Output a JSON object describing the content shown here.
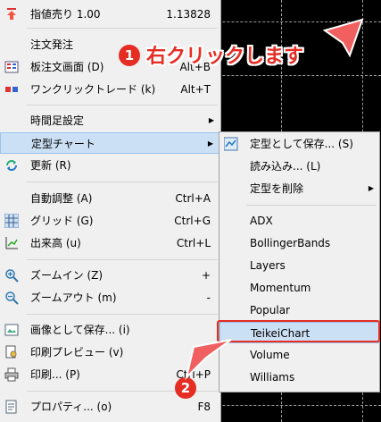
{
  "context_menu": {
    "items": [
      {
        "label": "指値売り 1.00",
        "shortcut": "1.13828",
        "icon": "sell-limit-arrow-icon"
      },
      {
        "label": "注文発注",
        "shortcut": "",
        "icon": ""
      },
      {
        "label": "板注文画面 (D)",
        "shortcut": "Alt+B",
        "icon": "order-book-icon"
      },
      {
        "label": "ワンクリックトレード (k)",
        "shortcut": "Alt+T",
        "icon": "one-click-trading-icon"
      },
      {
        "label": "時間足設定",
        "shortcut": "",
        "icon": ""
      },
      {
        "label": "定型チャート",
        "shortcut": "",
        "icon": ""
      },
      {
        "label": "更新 (R)",
        "shortcut": "",
        "icon": "refresh-icon"
      },
      {
        "label": "自動調整 (A)",
        "shortcut": "Ctrl+A",
        "icon": ""
      },
      {
        "label": "グリッド (G)",
        "shortcut": "Ctrl+G",
        "icon": "grid-icon"
      },
      {
        "label": "出来高 (u)",
        "shortcut": "Ctrl+L",
        "icon": "volume-icon"
      },
      {
        "label": "ズームイン (Z)",
        "shortcut": "+",
        "icon": "zoom-in-icon"
      },
      {
        "label": "ズームアウト (m)",
        "shortcut": "-",
        "icon": "zoom-out-icon"
      },
      {
        "label": "画像として保存... (i)",
        "shortcut": "",
        "icon": "save-image-icon"
      },
      {
        "label": "印刷プレビュー (v)",
        "shortcut": "",
        "icon": "print-preview-icon"
      },
      {
        "label": "印刷... (P)",
        "shortcut": "Ctrl+P",
        "icon": "print-icon"
      },
      {
        "label": "プロパティ... (o)",
        "shortcut": "F8",
        "icon": "properties-icon"
      }
    ]
  },
  "template_submenu": {
    "items": [
      {
        "label": "定型として保存... (S)",
        "icon": "save-template-icon"
      },
      {
        "label": "読み込み... (L)"
      },
      {
        "label": "定型を削除"
      },
      {
        "label": "ADX"
      },
      {
        "label": "BollingerBands"
      },
      {
        "label": "Layers"
      },
      {
        "label": "Momentum"
      },
      {
        "label": "Popular"
      },
      {
        "label": "TeikeiChart"
      },
      {
        "label": "Volume"
      },
      {
        "label": "Williams"
      }
    ]
  },
  "annotations": {
    "step1_number": "1",
    "step1_text": "右クリックします",
    "step2_number": "2"
  },
  "colors": {
    "highlight": "#cce0f5",
    "annotation_red": "#e52d24",
    "chart_background": "#000000"
  }
}
